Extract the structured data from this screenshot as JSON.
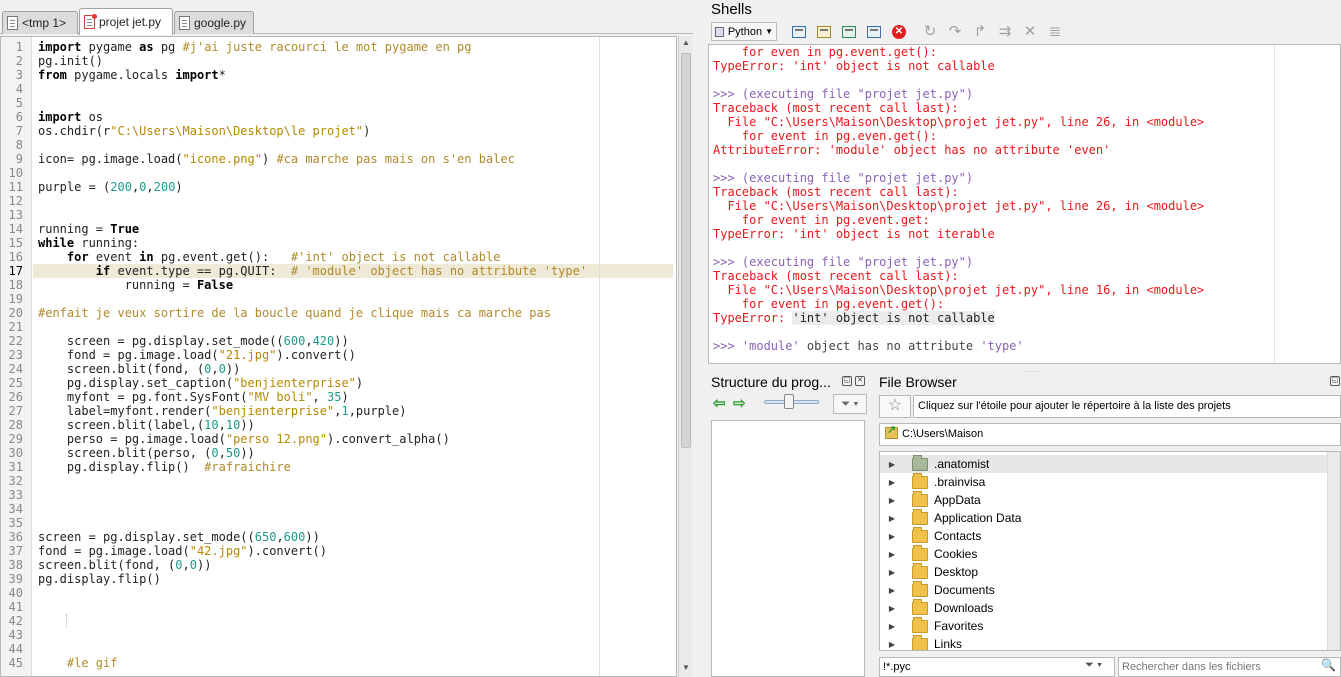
{
  "editor": {
    "tabs": [
      {
        "label": "<tmp 1>",
        "active": false
      },
      {
        "label": "projet jet.py",
        "active": true
      },
      {
        "label": "google.py",
        "active": false
      }
    ],
    "current_line": 17,
    "lines": [
      "import pygame as pg #j'ai juste racourci le mot pygame en pg",
      "pg.init()",
      "from pygame.locals import*",
      "",
      "",
      "import os",
      "os.chdir(r\"C:\\Users\\Maison\\Desktop\\le projet\")",
      "",
      "icon= pg.image.load(\"icone.png\") #ca marche pas mais on s'en balec",
      "",
      "purple = (200,0,200)",
      "",
      "",
      "running = True",
      "while running:",
      "    for event in pg.event.get():   #'int' object is not callable",
      "        if event.type == pg.QUIT:  # 'module' object has no attribute 'type'",
      "            running = False",
      "",
      "#enfait je veux sortire de la boucle quand je clique mais ca marche pas",
      "",
      "    screen = pg.display.set_mode((600,420))",
      "    fond = pg.image.load(\"21.jpg\").convert()",
      "    screen.blit(fond, (0,0))",
      "    pg.display.set_caption(\"benjienterprise\")",
      "    myfont = pg.font.SysFont(\"MV boli\", 35)",
      "    label=myfont.render(\"benjienterprise\",1,purple)",
      "    screen.blit(label,(10,10))",
      "    perso = pg.image.load(\"perso 12.png\").convert_alpha()",
      "    screen.blit(perso, (0,50))",
      "    pg.display.flip()  #rafraichire",
      "",
      "",
      "",
      "",
      "screen = pg.display.set_mode((650,600))",
      "fond = pg.image.load(\"42.jpg\").convert()",
      "screen.blit(fond, (0,0))",
      "pg.display.flip()",
      "",
      "",
      "",
      "",
      "",
      "    #le gif"
    ]
  },
  "shells": {
    "title": "Shells",
    "language": "Python",
    "toolbar": [
      "new-shell-icon",
      "open-icon",
      "reload-icon",
      "window-icon",
      "stop-icon",
      "run-icon",
      "step-icon",
      "step-in-icon",
      "step-out-icon",
      "close-debug-icon",
      "list-icon"
    ],
    "output": [
      {
        "text": "    for even in pg.event.get():",
        "kind": "red"
      },
      {
        "text": "TypeError: 'int' object is not callable",
        "kind": "red"
      },
      {
        "text": "",
        "kind": "plain"
      },
      {
        "text": ">>> (executing file \"projet jet.py\")",
        "kind": "prompt"
      },
      {
        "text": "Traceback (most recent call last):",
        "kind": "red"
      },
      {
        "text": "  File \"C:\\Users\\Maison\\Desktop\\projet jet.py\", line 26, in <module>",
        "kind": "red"
      },
      {
        "text": "    for event in pg.even.get():",
        "kind": "red"
      },
      {
        "text": "AttributeError: 'module' object has no attribute 'even'",
        "kind": "red"
      },
      {
        "text": "",
        "kind": "plain"
      },
      {
        "text": ">>> (executing file \"projet jet.py\")",
        "kind": "prompt"
      },
      {
        "text": "Traceback (most recent call last):",
        "kind": "red"
      },
      {
        "text": "  File \"C:\\Users\\Maison\\Desktop\\projet jet.py\", line 26, in <module>",
        "kind": "red"
      },
      {
        "text": "    for event in pg.event.get:",
        "kind": "red"
      },
      {
        "text": "TypeError: 'int' object is not iterable",
        "kind": "red"
      },
      {
        "text": "",
        "kind": "plain"
      },
      {
        "text": ">>> (executing file \"projet jet.py\")",
        "kind": "prompt"
      },
      {
        "text": "Traceback (most recent call last):",
        "kind": "red"
      },
      {
        "text": "  File \"C:\\Users\\Maison\\Desktop\\projet jet.py\", line 16, in <module>",
        "kind": "red"
      },
      {
        "text": "    for event in pg.event.get():",
        "kind": "red"
      },
      {
        "text": "TypeError: 'int' object is not callable",
        "kind": "red-sel"
      },
      {
        "text": "",
        "kind": "plain"
      },
      {
        "text": ">>> 'module' object has no attribute 'type'",
        "kind": "input"
      }
    ]
  },
  "structure": {
    "title": "Structure du prog..."
  },
  "file_browser": {
    "title": "File Browser",
    "projects_placeholder": "Cliquez sur l'étoile pour ajouter le répertoire à la liste des projets",
    "path": "C:\\Users\\Maison",
    "items": [
      ".anatomist",
      ".brainvisa",
      "AppData",
      "Application Data",
      "Contacts",
      "Cookies",
      "Desktop",
      "Documents",
      "Downloads",
      "Favorites",
      "Links"
    ],
    "filter": "!*.pyc",
    "search_placeholder": "Rechercher dans les fichiers"
  },
  "colors": {
    "error_red": "#e8171b",
    "prompt_purple": "#8a62b5",
    "string_gold": "#b58900",
    "number_teal": "#1e9a8a",
    "current_line_bg": "#efe9d7"
  }
}
